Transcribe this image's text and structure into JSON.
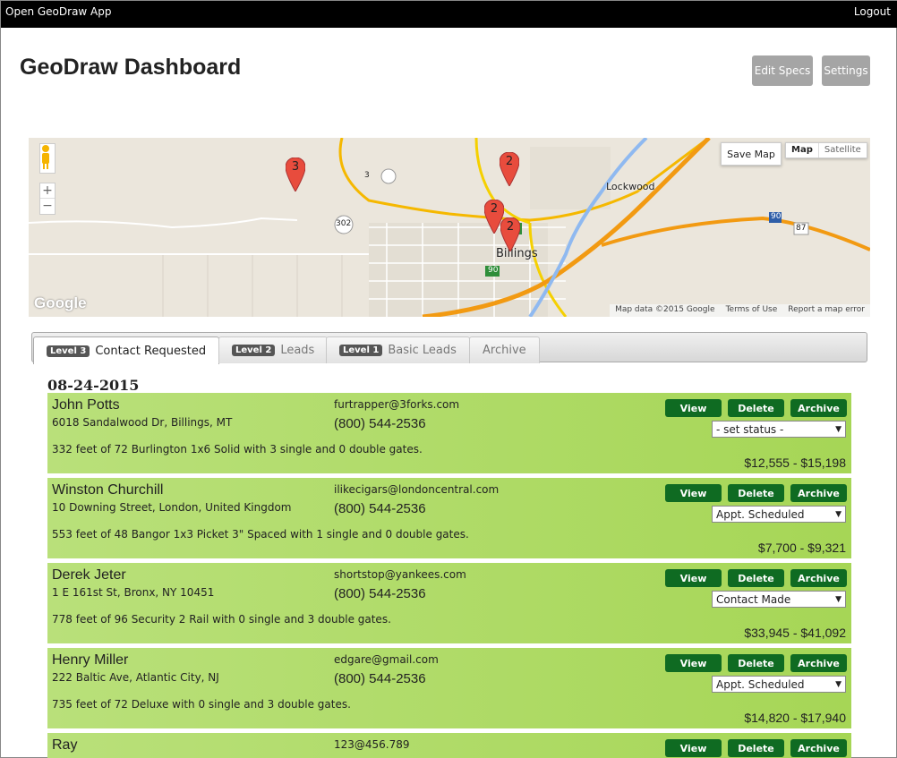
{
  "topbar": {
    "app_link": "Open GeoDraw App",
    "logout": "Logout"
  },
  "header": {
    "title": "GeoDraw Dashboard",
    "edit_specs": "Edit Specs",
    "settings": "Settings"
  },
  "map": {
    "save_map": "Save Map",
    "type_map": "Map",
    "type_satellite": "Satellite",
    "logo": "Google",
    "attribution": [
      "Map data ©2015 Google",
      "Terms of Use",
      "Report a map error"
    ],
    "place_labels": [
      "Billings",
      "Lockwood"
    ],
    "route_labels": [
      "3",
      "302",
      "90",
      "90",
      "87"
    ],
    "markers": [
      "3",
      "2",
      "2",
      "2"
    ]
  },
  "tabs": [
    {
      "badge": "Level 3",
      "label": "Contact Requested"
    },
    {
      "badge": "Level 2",
      "label": "Leads"
    },
    {
      "badge": "Level 1",
      "label": "Basic Leads"
    },
    {
      "badge": "",
      "label": "Archive"
    }
  ],
  "date_group": "08-24-2015",
  "leads": [
    {
      "name": "John Potts",
      "address": "6018 Sandalwood Dr, Billings, MT",
      "email": "furtrapper@3forks.com",
      "phone": "(800) 544-2536",
      "description": "332 feet of 72 Burlington 1x6 Solid with 3 single and 0 double gates.",
      "price": "$12,555 - $15,198",
      "status": "- set status -"
    },
    {
      "name": "Winston Churchill",
      "address": "10 Downing Street, London, United Kingdom",
      "email": "ilikecigars@londoncentral.com",
      "phone": "(800) 544-2536",
      "description": "553 feet of 48 Bangor 1x3 Picket 3\" Spaced with 1 single and 0 double gates.",
      "price": "$7,700 - $9,321",
      "status": "Appt. Scheduled"
    },
    {
      "name": "Derek Jeter",
      "address": "1 E 161st St, Bronx, NY 10451",
      "email": "shortstop@yankees.com",
      "phone": "(800) 544-2536",
      "description": "778 feet of 96 Security 2 Rail with 0 single and 3 double gates.",
      "price": "$33,945 - $41,092",
      "status": "Contact Made"
    },
    {
      "name": "Henry Miller",
      "address": "222 Baltic Ave, Atlantic City, NJ",
      "email": "edgare@gmail.com",
      "phone": "(800) 544-2536",
      "description": "735 feet of 72 Deluxe with 0 single and 3 double gates.",
      "price": "$14,820 - $17,940",
      "status": "Appt. Scheduled"
    },
    {
      "name": "Ray",
      "address": "",
      "email": "123@456.789",
      "phone": "",
      "description": "",
      "price": "",
      "status": ""
    }
  ],
  "row_buttons": {
    "view": "View",
    "delete": "Delete",
    "archive": "Archive"
  }
}
